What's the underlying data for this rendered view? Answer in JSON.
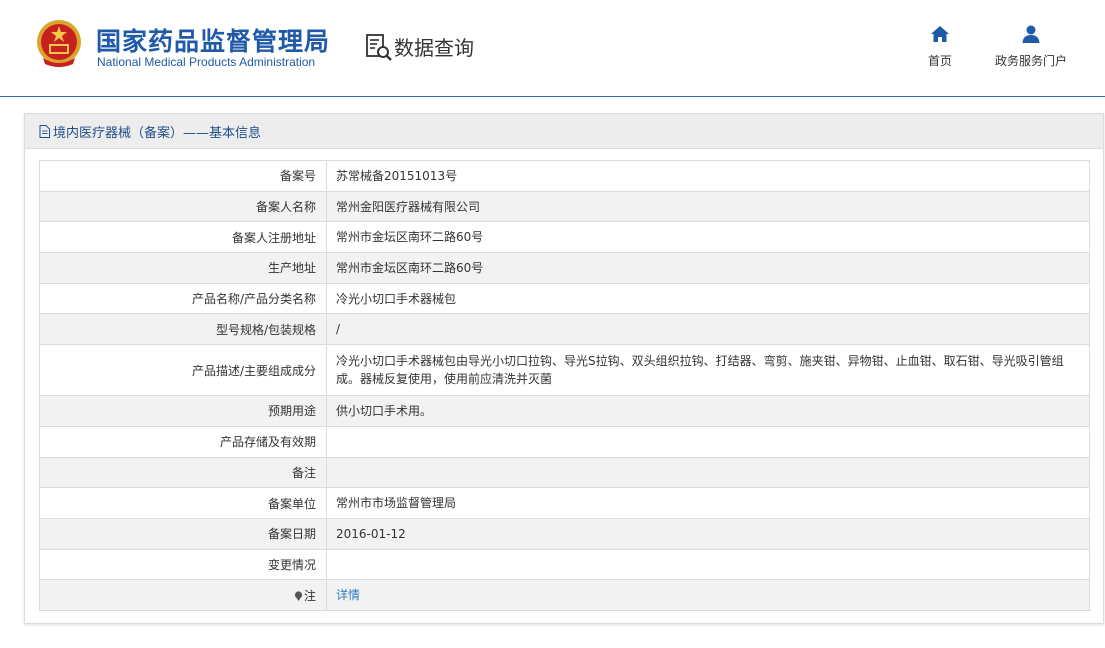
{
  "header": {
    "agency_cn": "国家药品监督管理局",
    "agency_en": "National Medical Products Administration",
    "section": "数据查询",
    "nav": [
      {
        "label": "首页",
        "icon": "home-icon"
      },
      {
        "label": "政务服务门户",
        "icon": "user-icon"
      }
    ]
  },
  "panel": {
    "title": "境内医疗器械（备案）——基本信息"
  },
  "record": [
    {
      "label": "备案号",
      "value": "苏常械备20151013号"
    },
    {
      "label": "备案人名称",
      "value": "常州金阳医疗器械有限公司"
    },
    {
      "label": "备案人注册地址",
      "value": "常州市金坛区南环二路60号"
    },
    {
      "label": "生产地址",
      "value": "常州市金坛区南环二路60号"
    },
    {
      "label": "产品名称/产品分类名称",
      "value": "冷光小切口手术器械包"
    },
    {
      "label": "型号规格/包装规格",
      "value": "/"
    },
    {
      "label": "产品描述/主要组成成分",
      "value": "冷光小切口手术器械包由导光小切口拉钩、导光S拉钩、双头组织拉钩、打结器、弯剪、施夹钳、异物钳、止血钳、取石钳、导光吸引管组成。器械反复使用，使用前应清洗并灭菌"
    },
    {
      "label": "预期用途",
      "value": "供小切口手术用。"
    },
    {
      "label": "产品存储及有效期",
      "value": ""
    },
    {
      "label": "备注",
      "value": ""
    },
    {
      "label": "备案单位",
      "value": "常州市市场监督管理局"
    },
    {
      "label": "备案日期",
      "value": "2016-01-12"
    },
    {
      "label": "变更情况",
      "value": ""
    },
    {
      "label": "注",
      "value": "详情"
    }
  ],
  "colors": {
    "brand_blue": "#1f5aa8",
    "link_blue": "#2e7cc4",
    "stripe_gray": "#f2f2f2"
  }
}
